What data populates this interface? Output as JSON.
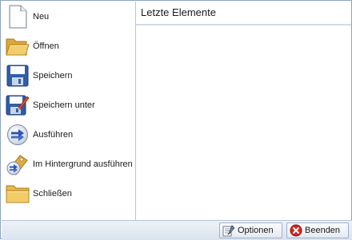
{
  "menu": {
    "items": [
      {
        "label": "Neu",
        "icon": "new-document-icon"
      },
      {
        "label": "Öffnen",
        "icon": "open-folder-icon"
      },
      {
        "label": "Speichern",
        "icon": "save-icon"
      },
      {
        "label": "Speichern unter",
        "icon": "save-as-icon"
      },
      {
        "label": "Ausführen",
        "icon": "run-icon"
      },
      {
        "label": "Im Hintergrund ausführen",
        "icon": "run-background-icon"
      },
      {
        "label": "Schließen",
        "icon": "close-folder-icon"
      }
    ]
  },
  "recent": {
    "title": "Letzte Elemente"
  },
  "footer": {
    "options_label": "Optionen",
    "options_icon": "options-icon",
    "exit_label": "Beenden",
    "exit_icon": "exit-icon"
  },
  "colors": {
    "border": "#8ea3c0",
    "footer_top": "#eef2f8",
    "footer_bottom": "#dbe3ee",
    "exit_red": "#d7261e"
  }
}
